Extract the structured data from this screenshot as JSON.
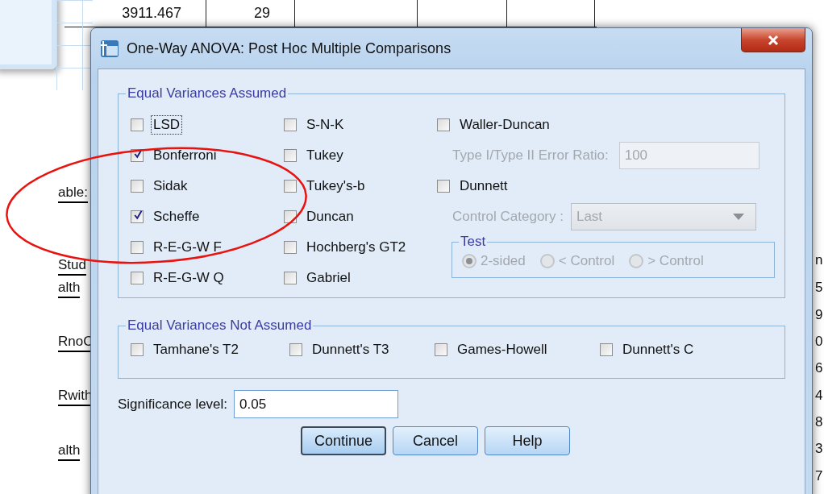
{
  "background": {
    "table_cells": [
      "3911.467",
      "29"
    ],
    "left_labels": [
      "able:",
      "Stud",
      "alth",
      "RnoC",
      "Rwith",
      "alth"
    ],
    "right_digits": [
      "n",
      "5",
      "9",
      "0",
      "6",
      "4",
      "8",
      "3",
      "7"
    ]
  },
  "dialog": {
    "title": "One-Way ANOVA: Post Hoc Multiple Comparisons",
    "equal_assumed": {
      "legend": "Equal Variances Assumed",
      "column_1": [
        {
          "label": "LSD",
          "checked": false,
          "focused": true
        },
        {
          "label": "Bonferroni",
          "checked": true,
          "focused": false
        },
        {
          "label": "Sidak",
          "checked": false,
          "focused": false
        },
        {
          "label": "Scheffe",
          "checked": true,
          "focused": false
        },
        {
          "label": "R-E-G-W F",
          "checked": false,
          "focused": false
        },
        {
          "label": "R-E-G-W Q",
          "checked": false,
          "focused": false
        }
      ],
      "column_2": [
        {
          "label": "S-N-K",
          "checked": false
        },
        {
          "label": "Tukey",
          "checked": false
        },
        {
          "label": "Tukey's-b",
          "checked": false
        },
        {
          "label": "Duncan",
          "checked": false
        },
        {
          "label": "Hochberg's GT2",
          "checked": false
        },
        {
          "label": "Gabriel",
          "checked": false
        }
      ],
      "waller_duncan": {
        "label": "Waller-Duncan",
        "checked": false
      },
      "error_ratio": {
        "label": "Type I/Type II Error Ratio:",
        "value": "100",
        "disabled": true
      },
      "dunnett": {
        "label": "Dunnett",
        "checked": false
      },
      "control_category": {
        "label": "Control Category :",
        "value": "Last",
        "disabled": true
      },
      "test": {
        "legend": "Test",
        "disabled": true,
        "options": [
          {
            "label": "2-sided",
            "selected": true
          },
          {
            "label": "< Control",
            "selected": false
          },
          {
            "label": "> Control",
            "selected": false
          }
        ]
      }
    },
    "equal_not_assumed": {
      "legend": "Equal Variances Not Assumed",
      "items": [
        {
          "label": "Tamhane's T2",
          "checked": false
        },
        {
          "label": "Dunnett's T3",
          "checked": false
        },
        {
          "label": "Games-Howell",
          "checked": false
        },
        {
          "label": "Dunnett's C",
          "checked": false
        }
      ]
    },
    "significance": {
      "label": "Significance level:",
      "value": "0.05"
    },
    "buttons": [
      {
        "label": "Continue",
        "default": true
      },
      {
        "label": "Cancel",
        "default": false
      },
      {
        "label": "Help",
        "default": false
      }
    ]
  }
}
